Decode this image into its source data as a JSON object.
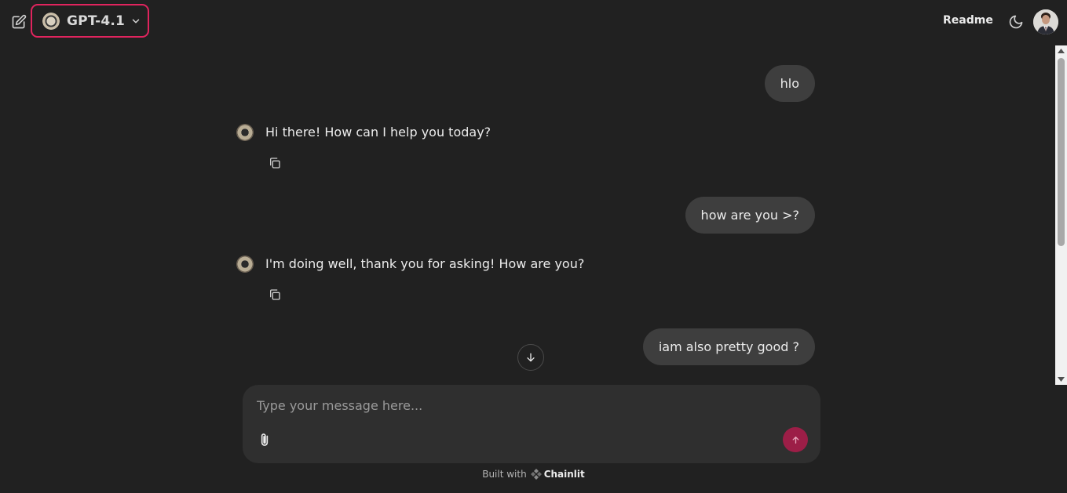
{
  "header": {
    "model_name": "GPT-4.1",
    "readme_label": "Readme",
    "accent_color": "#e0245e"
  },
  "messages": [
    {
      "role": "user",
      "text": "hlo"
    },
    {
      "role": "assistant",
      "text": "Hi there! How can I help you today?"
    },
    {
      "role": "user",
      "text": "how are you >?"
    },
    {
      "role": "assistant",
      "text": "I'm doing well, thank you for asking!  How are you?"
    },
    {
      "role": "user",
      "text": "iam also pretty good ?"
    }
  ],
  "composer": {
    "placeholder": "Type your message here...",
    "send_color": "#9c1e47"
  },
  "footer": {
    "built_with": "Built with",
    "brand": "Chainlit"
  },
  "icons": {
    "new_chat": "new-chat-icon",
    "chevron": "chevron-down-icon",
    "theme": "moon-icon",
    "copy": "copy-icon",
    "scroll": "arrow-down-icon",
    "attach": "paperclip-icon",
    "send": "arrow-up-icon"
  }
}
